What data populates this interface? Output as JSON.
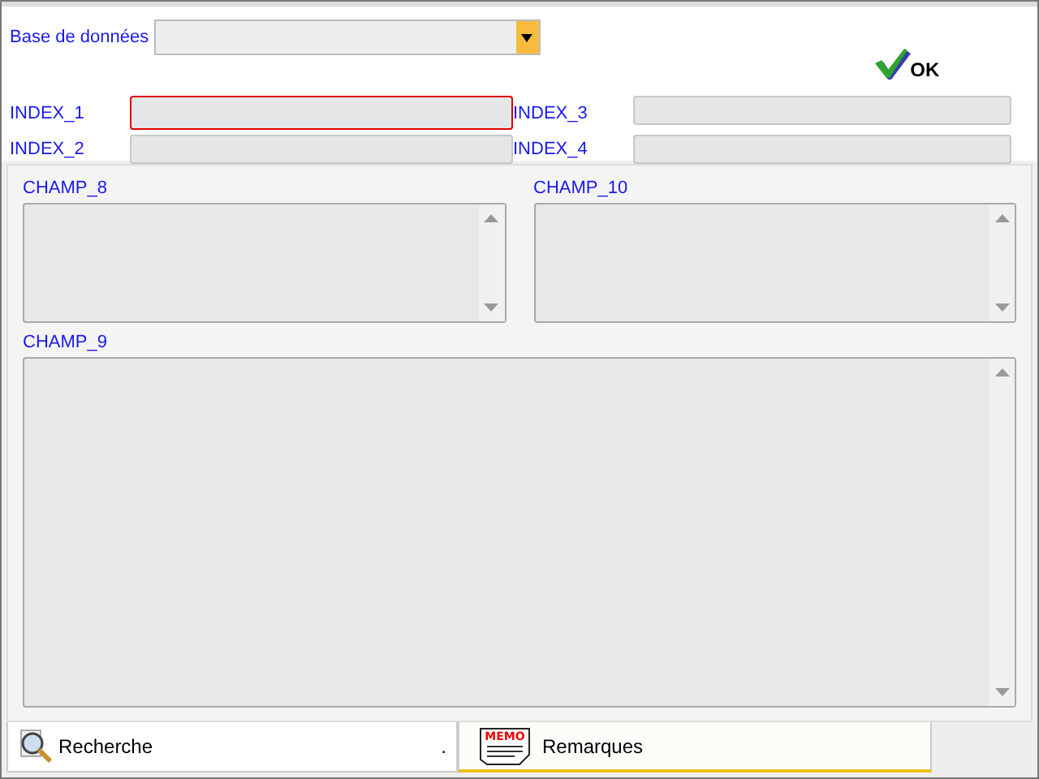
{
  "database": {
    "label": "Base de données"
  },
  "ok_button": {
    "label": "OK"
  },
  "index_fields": [
    {
      "label": "INDEX_1",
      "focused": true
    },
    {
      "label": "INDEX_3",
      "focused": false
    },
    {
      "label": "INDEX_2",
      "focused": false
    },
    {
      "label": "INDEX_4",
      "focused": false
    }
  ],
  "memo_fields": [
    {
      "label": "CHAMP_8"
    },
    {
      "label": "CHAMP_10"
    },
    {
      "label": "CHAMP_9"
    }
  ],
  "tabs": [
    {
      "label": "Recherche",
      "kind": "search",
      "selected": false,
      "trailing": "."
    },
    {
      "label": "Remarques",
      "kind": "memo",
      "selected": true,
      "icon_text": "MEMO"
    }
  ]
}
